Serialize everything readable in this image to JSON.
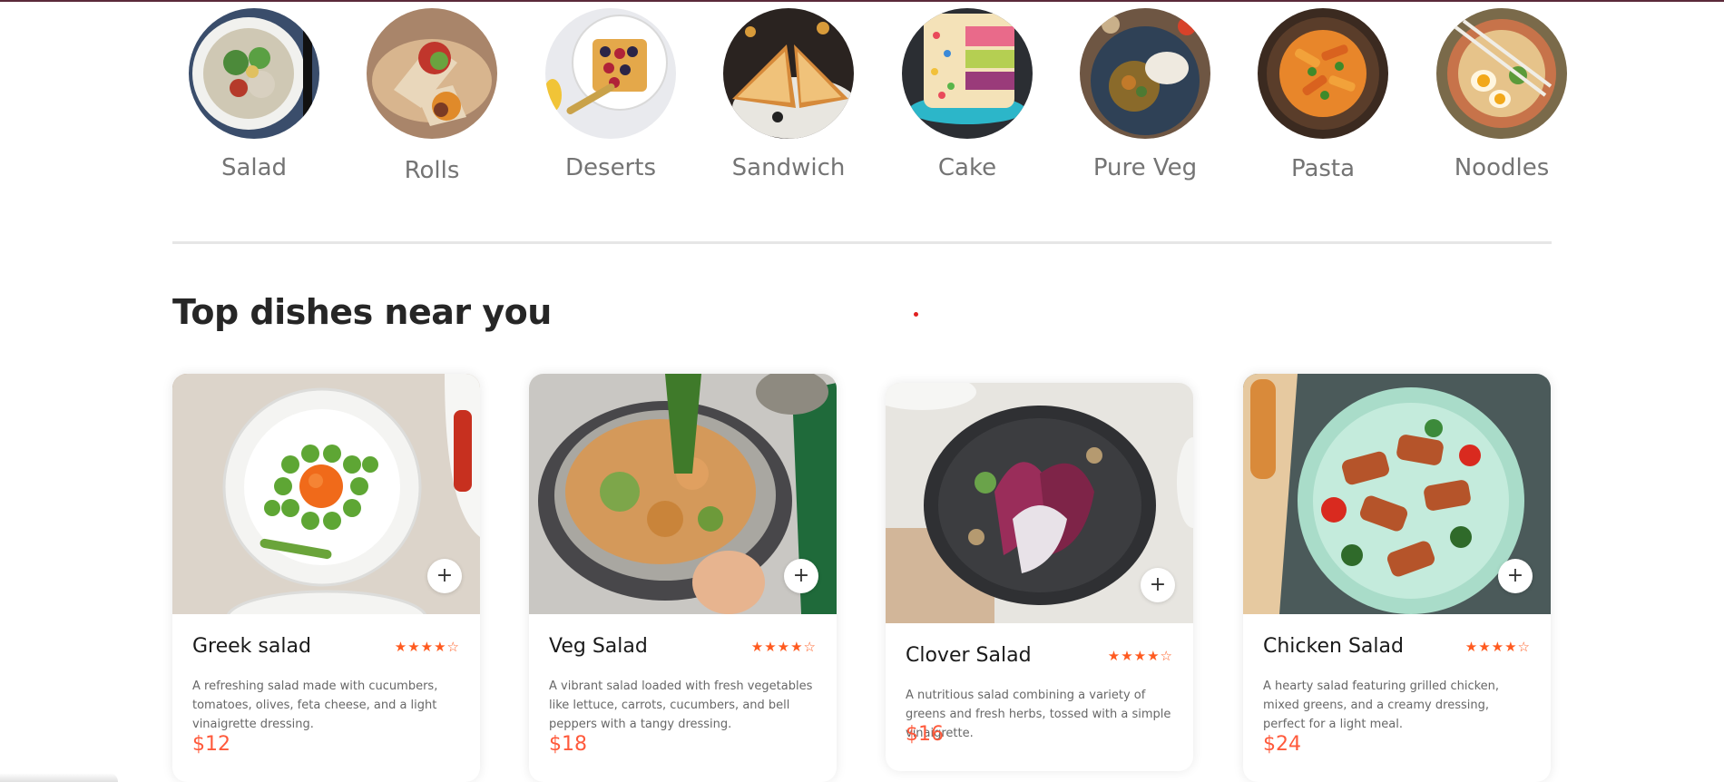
{
  "menu": [
    {
      "label": "Salad",
      "icon": "salad-bowl-image"
    },
    {
      "label": "Rolls",
      "icon": "wrap-rolls-image"
    },
    {
      "label": "Deserts",
      "icon": "waffle-dessert-image"
    },
    {
      "label": "Sandwich",
      "icon": "sandwich-image"
    },
    {
      "label": "Cake",
      "icon": "layer-cake-image"
    },
    {
      "label": "Pure Veg",
      "icon": "veg-curry-plate-image"
    },
    {
      "label": "Pasta",
      "icon": "penne-pasta-image"
    },
    {
      "label": "Noodles",
      "icon": "ramen-noodles-image"
    }
  ],
  "section": {
    "title": "Top dishes near you"
  },
  "dishes": [
    {
      "name": "Greek salad",
      "rating": "★★★★☆",
      "description": "A refreshing salad made with cucumbers, tomatoes, olives, feta cheese, and a light vinaigrette dressing.",
      "price": "$12",
      "add_label": "+"
    },
    {
      "name": "Veg Salad",
      "rating": "★★★★☆",
      "description": "A vibrant salad loaded with fresh vegetables like lettuce, carrots, cucumbers, and bell peppers with a tangy dressing.",
      "price": "$18",
      "add_label": "+"
    },
    {
      "name": "Clover Salad",
      "rating": "★★★★☆",
      "description": "A nutritious salad combining a variety of greens and fresh herbs, tossed with a simple vinaigrette.",
      "price": "$16",
      "add_label": "+"
    },
    {
      "name": "Chicken Salad",
      "rating": "★★★★☆",
      "description": "A hearty salad featuring grilled chicken, mixed greens, and a creamy dressing, perfect for a light meal.",
      "price": "$24",
      "add_label": "+"
    }
  ],
  "colors": {
    "accent": "#ff5a3c",
    "star": "#ff5a1f",
    "title": "#262626",
    "label": "#747474"
  }
}
